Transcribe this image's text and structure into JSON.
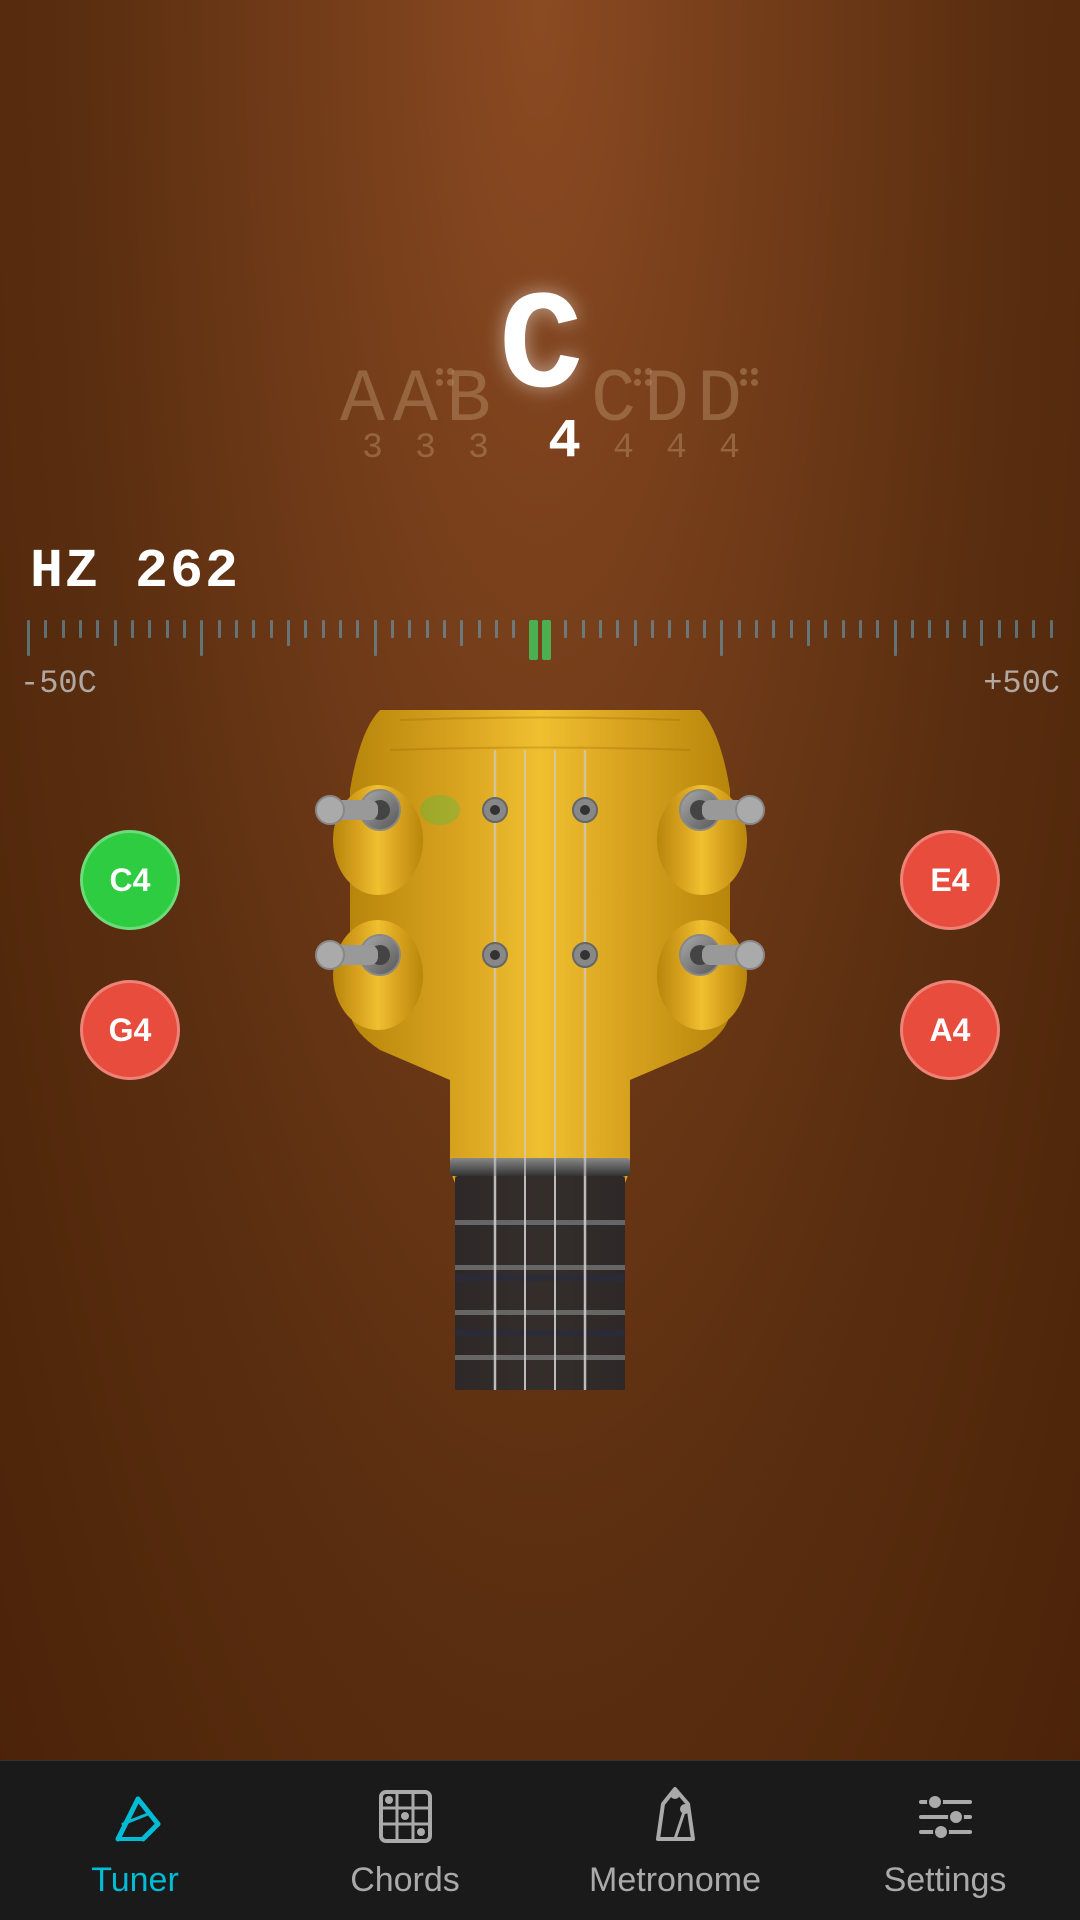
{
  "background": {
    "color": "#6B3A1F"
  },
  "note_display": {
    "notes": [
      {
        "letter": "A",
        "subscript": "3",
        "sharp": false,
        "active": false
      },
      {
        "letter": "A",
        "subscript": "3",
        "sharp": true,
        "active": false
      },
      {
        "letter": "B",
        "subscript": "3",
        "sharp": false,
        "active": false
      },
      {
        "letter": "C",
        "subscript": "4",
        "sharp": false,
        "active": true
      },
      {
        "letter": "C",
        "subscript": "4",
        "sharp": true,
        "active": false
      },
      {
        "letter": "D",
        "subscript": "4",
        "sharp": false,
        "active": false
      },
      {
        "letter": "D",
        "subscript": "4",
        "sharp": true,
        "active": false
      }
    ]
  },
  "frequency": {
    "label": "HZ 262"
  },
  "cents": {
    "min_label": "-50C",
    "max_label": "+50C"
  },
  "strings": [
    {
      "note": "C4",
      "color": "green",
      "position": "top-left"
    },
    {
      "note": "E4",
      "color": "red",
      "position": "top-right"
    },
    {
      "note": "G4",
      "color": "red",
      "position": "bottom-left"
    },
    {
      "note": "A4",
      "color": "red",
      "position": "bottom-right"
    }
  ],
  "nav": {
    "items": [
      {
        "label": "Tuner",
        "active": true,
        "icon": "tuner-icon"
      },
      {
        "label": "Chords",
        "active": false,
        "icon": "chords-icon"
      },
      {
        "label": "Metronome",
        "active": false,
        "icon": "metronome-icon"
      },
      {
        "label": "Settings",
        "active": false,
        "icon": "settings-icon"
      }
    ]
  }
}
